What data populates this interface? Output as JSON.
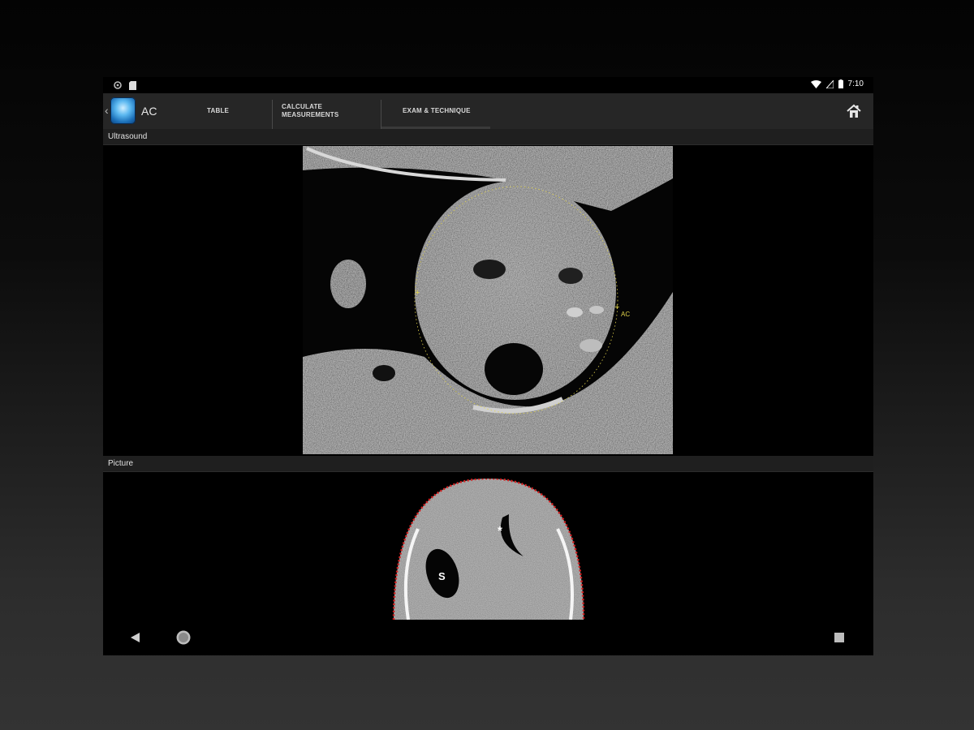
{
  "status_bar": {
    "time": "7:10",
    "icons": [
      "settings-icon",
      "sd-card-icon",
      "wifi-icon",
      "signal-icon",
      "battery-icon"
    ]
  },
  "app_bar": {
    "title": "AC",
    "tabs": [
      {
        "label": "TABLE",
        "selected": false
      },
      {
        "label": "CALCULATE MEASUREMENTS",
        "selected": false
      },
      {
        "label": "EXAM & TECHNIQUE",
        "selected": true
      }
    ],
    "icons": [
      "back-chevron-icon",
      "app-logo-icon",
      "home-icon"
    ]
  },
  "sections": {
    "ultrasound": {
      "title": "Ultrasound",
      "caliper_label": "AC"
    },
    "picture": {
      "title": "Picture",
      "labels": {
        "stomach": "S",
        "vein": "*"
      }
    }
  },
  "nav_bar": {
    "icons": [
      "back-triangle-icon",
      "home-circle-icon",
      "recents-square-icon"
    ]
  },
  "colors": {
    "app_bar_bg": "#262626",
    "caliper": "#e0d24a",
    "diagram_outline": "#d62020"
  }
}
